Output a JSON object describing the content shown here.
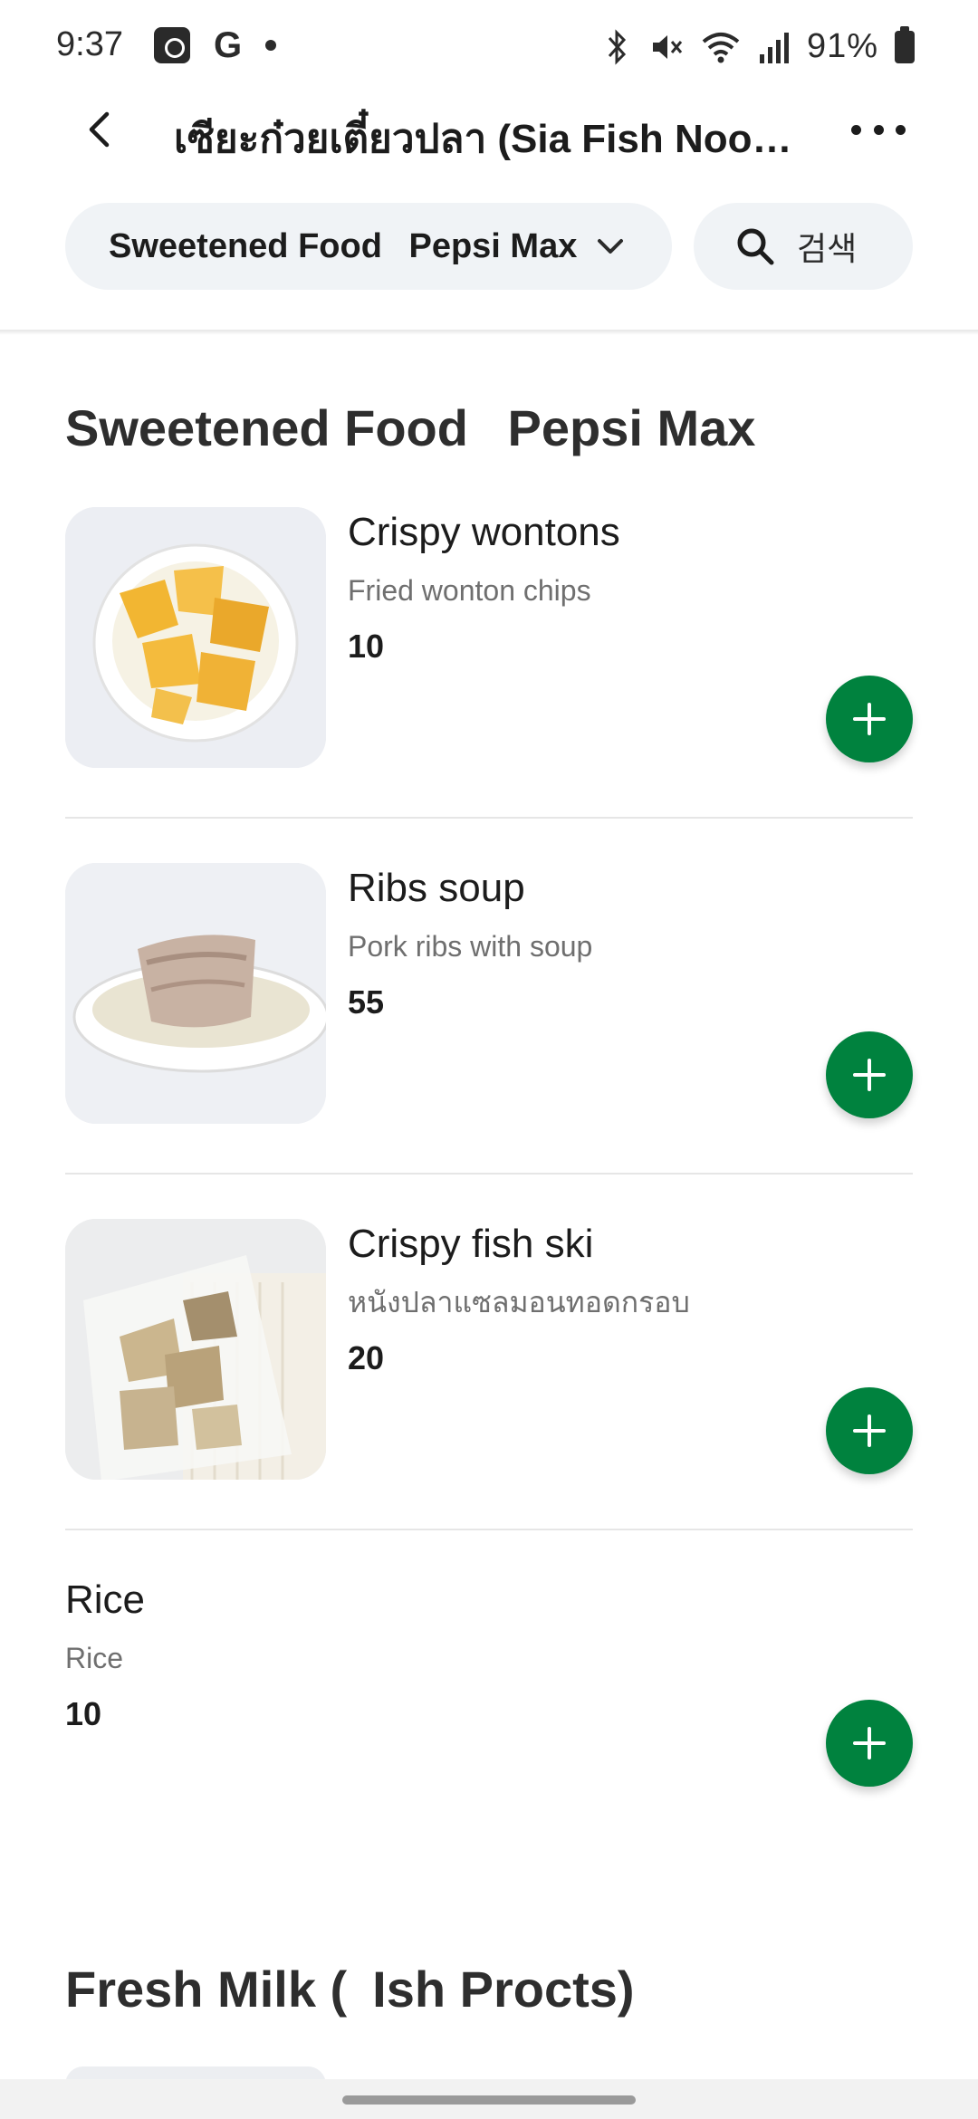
{
  "status_bar": {
    "time": "9:37",
    "battery": "91%",
    "icons": [
      "app-badge-icon",
      "g-icon",
      "notification-dot-icon",
      "bluetooth-icon",
      "mute-icon",
      "wifi-icon",
      "signal-icon",
      "battery-icon"
    ]
  },
  "header": {
    "title": "เซียะก๋วยเตี๋ยวปลา (Sia Fish Noodle...",
    "back_icon": "chevron-left-icon",
    "more_icon": "more-horizontal-icon"
  },
  "filter": {
    "category_label": "Sweetened Food  Pepsi Max",
    "search_label": "검색"
  },
  "sections": [
    {
      "title": "Sweetened Food  Pepsi Max",
      "items": [
        {
          "name": "Crispy wontons",
          "description": "Fried wonton chips",
          "price": "10"
        },
        {
          "name": "Ribs soup",
          "description": "Pork ribs with soup",
          "price": "55"
        },
        {
          "name": "Crispy fish ski",
          "description": "หนังปลาแซลมอนทอดกรอบ",
          "price": "20"
        },
        {
          "name": "Rice",
          "description": "Rice",
          "price": "10"
        }
      ]
    },
    {
      "title": "Fresh Milk ( Ish Procts)"
    }
  ],
  "colors": {
    "accent_green": "#00823e",
    "pill_background": "#f0f3f6"
  }
}
